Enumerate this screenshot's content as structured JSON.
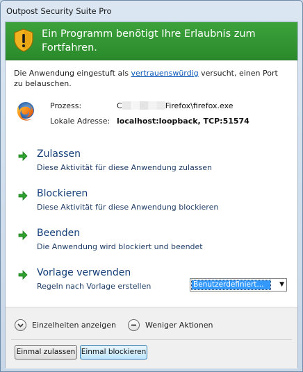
{
  "window": {
    "title": "Outpost Security Suite Pro"
  },
  "banner": {
    "text": "Ein Programm benötigt Ihre Erlaubnis zum Fortfahren."
  },
  "description": {
    "prefix": "Die Anwendung eingestuft als ",
    "link": "vertrauenswürdig",
    "suffix": " versucht, einen Port zu belauschen."
  },
  "process": {
    "label": "Prozess:",
    "value_start": "C",
    "value_end": "Firefox\\firefox.exe"
  },
  "address": {
    "label": "Lokale Adresse:",
    "value": "localhost:loopback, TCP:51574"
  },
  "actions": [
    {
      "title": "Zulassen",
      "desc": "Diese Aktivität für diese Anwendung zulassen"
    },
    {
      "title": "Blockieren",
      "desc": "Diese Aktivität für diese Anwendung blockieren"
    },
    {
      "title": "Beenden",
      "desc": "Die Anwendung wird blockiert und beendet"
    },
    {
      "title": "Vorlage verwenden",
      "desc": "Regeln nach Vorlage erstellen"
    }
  ],
  "template_select": {
    "value": "Benutzerdefiniert..."
  },
  "toggles": {
    "details": "Einzelheiten anzeigen",
    "fewer": "Weniger Aktionen"
  },
  "buttons": {
    "allow_once": "Einmal zulassen",
    "block_once": "Einmal blockieren"
  },
  "colors": {
    "banner_green": "#2e8f2e",
    "action_arrow_green": "#2ea12e",
    "action_title_blue": "#133e7a",
    "link_blue": "#0a57b8"
  },
  "icons": [
    "shield-warning-icon",
    "firefox-icon",
    "arrow-right-icon",
    "chevron-down-icon",
    "minus-icon"
  ]
}
